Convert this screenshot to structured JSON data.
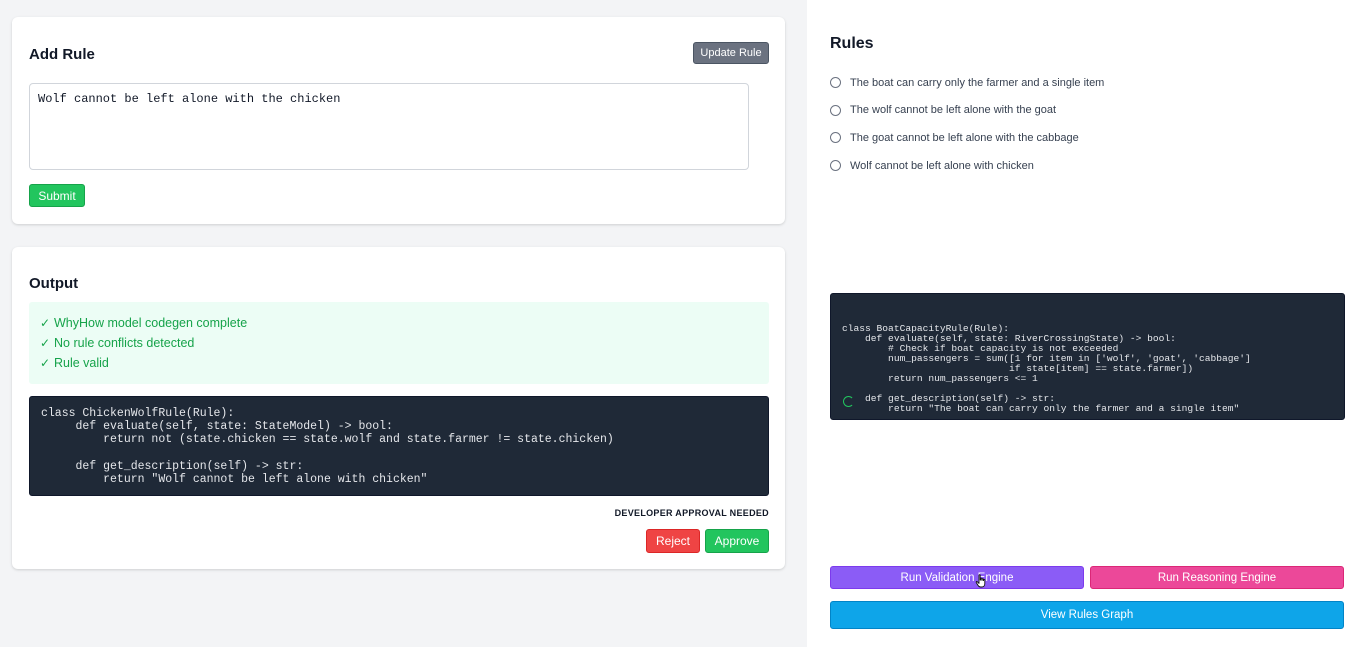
{
  "add_rule": {
    "title": "Add Rule",
    "update_button": "Update Rule",
    "input_value": "Wolf cannot be left alone with the chicken",
    "submit_button": "Submit"
  },
  "output": {
    "title": "Output",
    "status": [
      {
        "icon": "✓",
        "text": "WhyHow model codegen complete"
      },
      {
        "icon": "✓",
        "text": "No rule conflicts detected"
      },
      {
        "icon": "✓",
        "text": "Rule valid"
      }
    ],
    "code": "class ChickenWolfRule(Rule):\n     def evaluate(self, state: StateModel) -> bool:\n         return not (state.chicken == state.wolf and state.farmer != state.chicken)\n\n     def get_description(self) -> str:\n         return \"Wolf cannot be left alone with chicken\"",
    "approval_note": "DEVELOPER APPROVAL NEEDED",
    "reject_button": "Reject",
    "approve_button": "Approve"
  },
  "rules_panel": {
    "title": "Rules",
    "items": [
      "The boat can carry only the farmer and a single item",
      "The wolf cannot be left alone with the goat",
      "The goat cannot be left alone with the cabbage",
      "Wolf cannot be left alone with chicken"
    ],
    "code": "class BoatCapacityRule(Rule):\n    def evaluate(self, state: RiverCrossingState) -> bool:\n        # Check if boat capacity is not exceeded\n        num_passengers = sum([1 for item in ['wolf', 'goat', 'cabbage']\n                             if state[item] == state.farmer])\n        return num_passengers <= 1\n\n    def get_description(self) -> str:\n        return \"The boat can carry only the farmer and a single item\"",
    "run_validation_button": "Run Validation Engine",
    "run_reasoning_button": "Run Reasoning Engine",
    "view_graph_button": "View Rules Graph"
  },
  "colors": {
    "background": "#f3f4f6",
    "success": "#22c55e",
    "danger": "#ef4444",
    "neutral": "#6b7280",
    "validation": "#8b5cf6",
    "reasoning": "#ec4899",
    "graph": "#0ea5e9",
    "code_bg": "#1f2937"
  }
}
